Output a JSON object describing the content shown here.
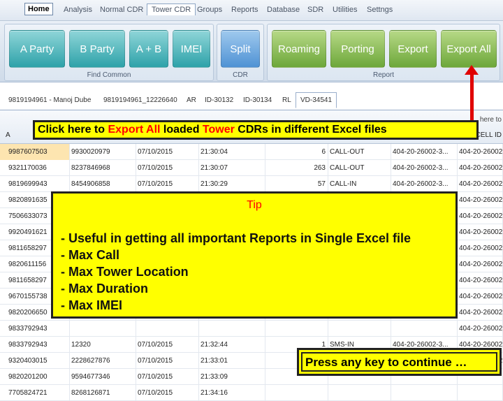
{
  "menu": {
    "home": "Home",
    "items": [
      "Analysis",
      "Normal CDR",
      "Tower CDR",
      "Groups",
      "Reports",
      "Database",
      "SDR",
      "Utilities",
      "Settngs"
    ]
  },
  "ribbon": {
    "group_find_common": {
      "label": "Find Common",
      "buttons": [
        "A Party",
        "B Party",
        "A + B",
        "IMEI"
      ]
    },
    "group_cdr": {
      "label": "CDR",
      "buttons": [
        "Split"
      ]
    },
    "group_report": {
      "label": "Report",
      "buttons": [
        "Roaming",
        "Porting",
        "Export",
        "Export All"
      ]
    }
  },
  "tabs": [
    "9819194961 - Manoj Dube",
    "9819194961_12226640",
    "AR",
    "ID-30132",
    "ID-30134",
    "RL",
    "VD-34541"
  ],
  "grid": {
    "hint": "here to",
    "header_right": "CELL ID",
    "header_left": "A",
    "rows": [
      [
        "9987607503",
        "9930020979",
        "07/10/2015",
        "21:30:04",
        "6",
        "CALL-OUT",
        "404-20-26002-3...",
        "404-20-26002"
      ],
      [
        "9321170036",
        "8237846968",
        "07/10/2015",
        "21:30:07",
        "263",
        "CALL-OUT",
        "404-20-26002-3...",
        "404-20-26002"
      ],
      [
        "9819699943",
        "8454906858",
        "07/10/2015",
        "21:30:29",
        "57",
        "CALL-IN",
        "404-20-26002-3...",
        "404-20-26002"
      ],
      [
        "9820891635",
        "",
        "",
        "",
        "",
        "",
        "",
        "404-20-26002"
      ],
      [
        "7506633073",
        "",
        "",
        "",
        "",
        "",
        "",
        "404-20-26002"
      ],
      [
        "9920491621",
        "",
        "",
        "",
        "",
        "",
        "",
        "404-20-26002"
      ],
      [
        "9811658297",
        "",
        "",
        "",
        "",
        "",
        "",
        "404-20-26002"
      ],
      [
        "9820611156",
        "",
        "",
        "",
        "",
        "",
        "",
        "404-20-26002"
      ],
      [
        "9811658297",
        "",
        "",
        "",
        "",
        "",
        "",
        "404-20-26002"
      ],
      [
        "9670155738",
        "",
        "",
        "",
        "",
        "",
        "",
        "404-20-26002"
      ],
      [
        "9820206650",
        "",
        "",
        "",
        "",
        "",
        "",
        "404-20-26002"
      ],
      [
        "9833792943",
        "",
        "",
        "",
        "",
        "",
        "",
        "404-20-26002"
      ],
      [
        "9833792943",
        "12320",
        "07/10/2015",
        "21:32:44",
        "1",
        "SMS-IN",
        "404-20-26002-3...",
        "404-20-26002"
      ],
      [
        "9320403015",
        "2228627876",
        "07/10/2015",
        "21:33:01",
        "1321",
        "CALL-OUT",
        "404-20-26002-3...",
        "404-20-26002"
      ],
      [
        "9820201200",
        "9594677346",
        "07/10/2015",
        "21:33:09",
        "",
        "",
        "",
        ""
      ],
      [
        "7705824721",
        "8268126871",
        "07/10/2015",
        "21:34:16",
        "",
        "",
        "",
        ""
      ]
    ]
  },
  "callout": {
    "part1": "Click here to ",
    "part2": "Export All",
    "part3": " loaded ",
    "part4": "Tower",
    "part5": " CDRs in different Excel files"
  },
  "tip": {
    "title": "Tip",
    "lines": [
      "- Useful in getting all important Reports in Single Excel file",
      "- Max Call",
      "- Max Tower Location",
      "- Max Duration",
      "- Max IMEI"
    ]
  },
  "continue_text": "Press any key to continue …",
  "colors": {
    "highlight": "#ffff00",
    "accent_red": "#ff0000"
  }
}
